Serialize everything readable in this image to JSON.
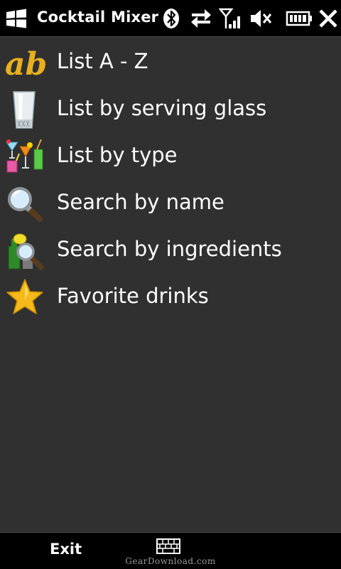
{
  "titlebar": {
    "title": "Cocktail Mixer",
    "icons": [
      "windows-start-icon",
      "bluetooth-icon",
      "data-sync-icon",
      "signal-strength-icon",
      "volume-muted-icon",
      "battery-icon",
      "close-icon"
    ]
  },
  "menu": {
    "items": [
      {
        "label": "List A - Z",
        "icon": "ab-letters-icon"
      },
      {
        "label": "List by serving glass",
        "icon": "glass-icon"
      },
      {
        "label": "List by type",
        "icon": "cocktails-icon"
      },
      {
        "label": "Search by name",
        "icon": "magnifier-icon"
      },
      {
        "label": "Search by ingredients",
        "icon": "ingredients-search-icon"
      },
      {
        "label": "Favorite drinks",
        "icon": "star-icon"
      }
    ]
  },
  "softkeys": {
    "left": "Exit",
    "center_icon": "keyboard-icon"
  },
  "watermark": "GearDownload.com",
  "colors": {
    "background": "#303030",
    "bars": "#000000",
    "text": "#ffffff",
    "star": "#f6b81a"
  }
}
